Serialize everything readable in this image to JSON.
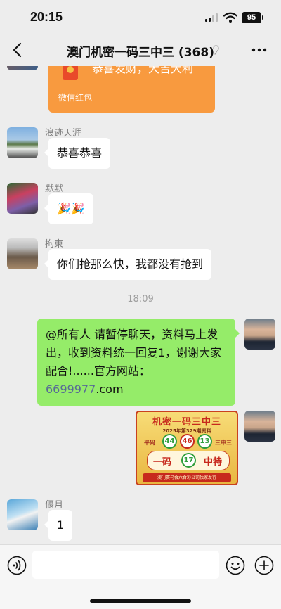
{
  "status_bar": {
    "time": "20:15",
    "battery": "95"
  },
  "nav": {
    "title": "澳门机密一码三中三 (368)"
  },
  "red_packet": {
    "wish": "恭喜发财，大吉大利",
    "type": "微信红包"
  },
  "messages": [
    {
      "nick": "浪迹天涯",
      "text": "恭喜恭喜"
    },
    {
      "nick": "默默",
      "text": "🎉🎉"
    },
    {
      "nick": "拘束",
      "text": "你们抢那么快，我都没有抢到"
    },
    {
      "nick": "偃月",
      "text": "1"
    }
  ],
  "timestamp": "18:09",
  "my_message": {
    "text_line1": "@所有人 请暂停聊天，资料马上发",
    "text_line2": "出，收到资料统一回复1，谢谢大家",
    "text_line3_prefix": "配合!......官方网站：",
    "link": "6699977",
    "text_line3_suffix": ".com"
  },
  "poster": {
    "title": "机密一码三中三",
    "subtitle": "2025年第329期资料",
    "left_label": "平码",
    "right_label": "三中三",
    "numbers": [
      "44",
      "46",
      "13"
    ],
    "number_colors": [
      "#2f9e3c",
      "#c7291d",
      "#2f9e3c"
    ],
    "special_left": "一码",
    "special_number": "17",
    "special_right": "中特",
    "special_color": "#2f9e3c",
    "footer": "澳门赛马会六合彩公司独家发行"
  },
  "colors": {
    "bubble_mine": "#95ec69",
    "link": "#576b95",
    "packet": "#f89a3f"
  }
}
